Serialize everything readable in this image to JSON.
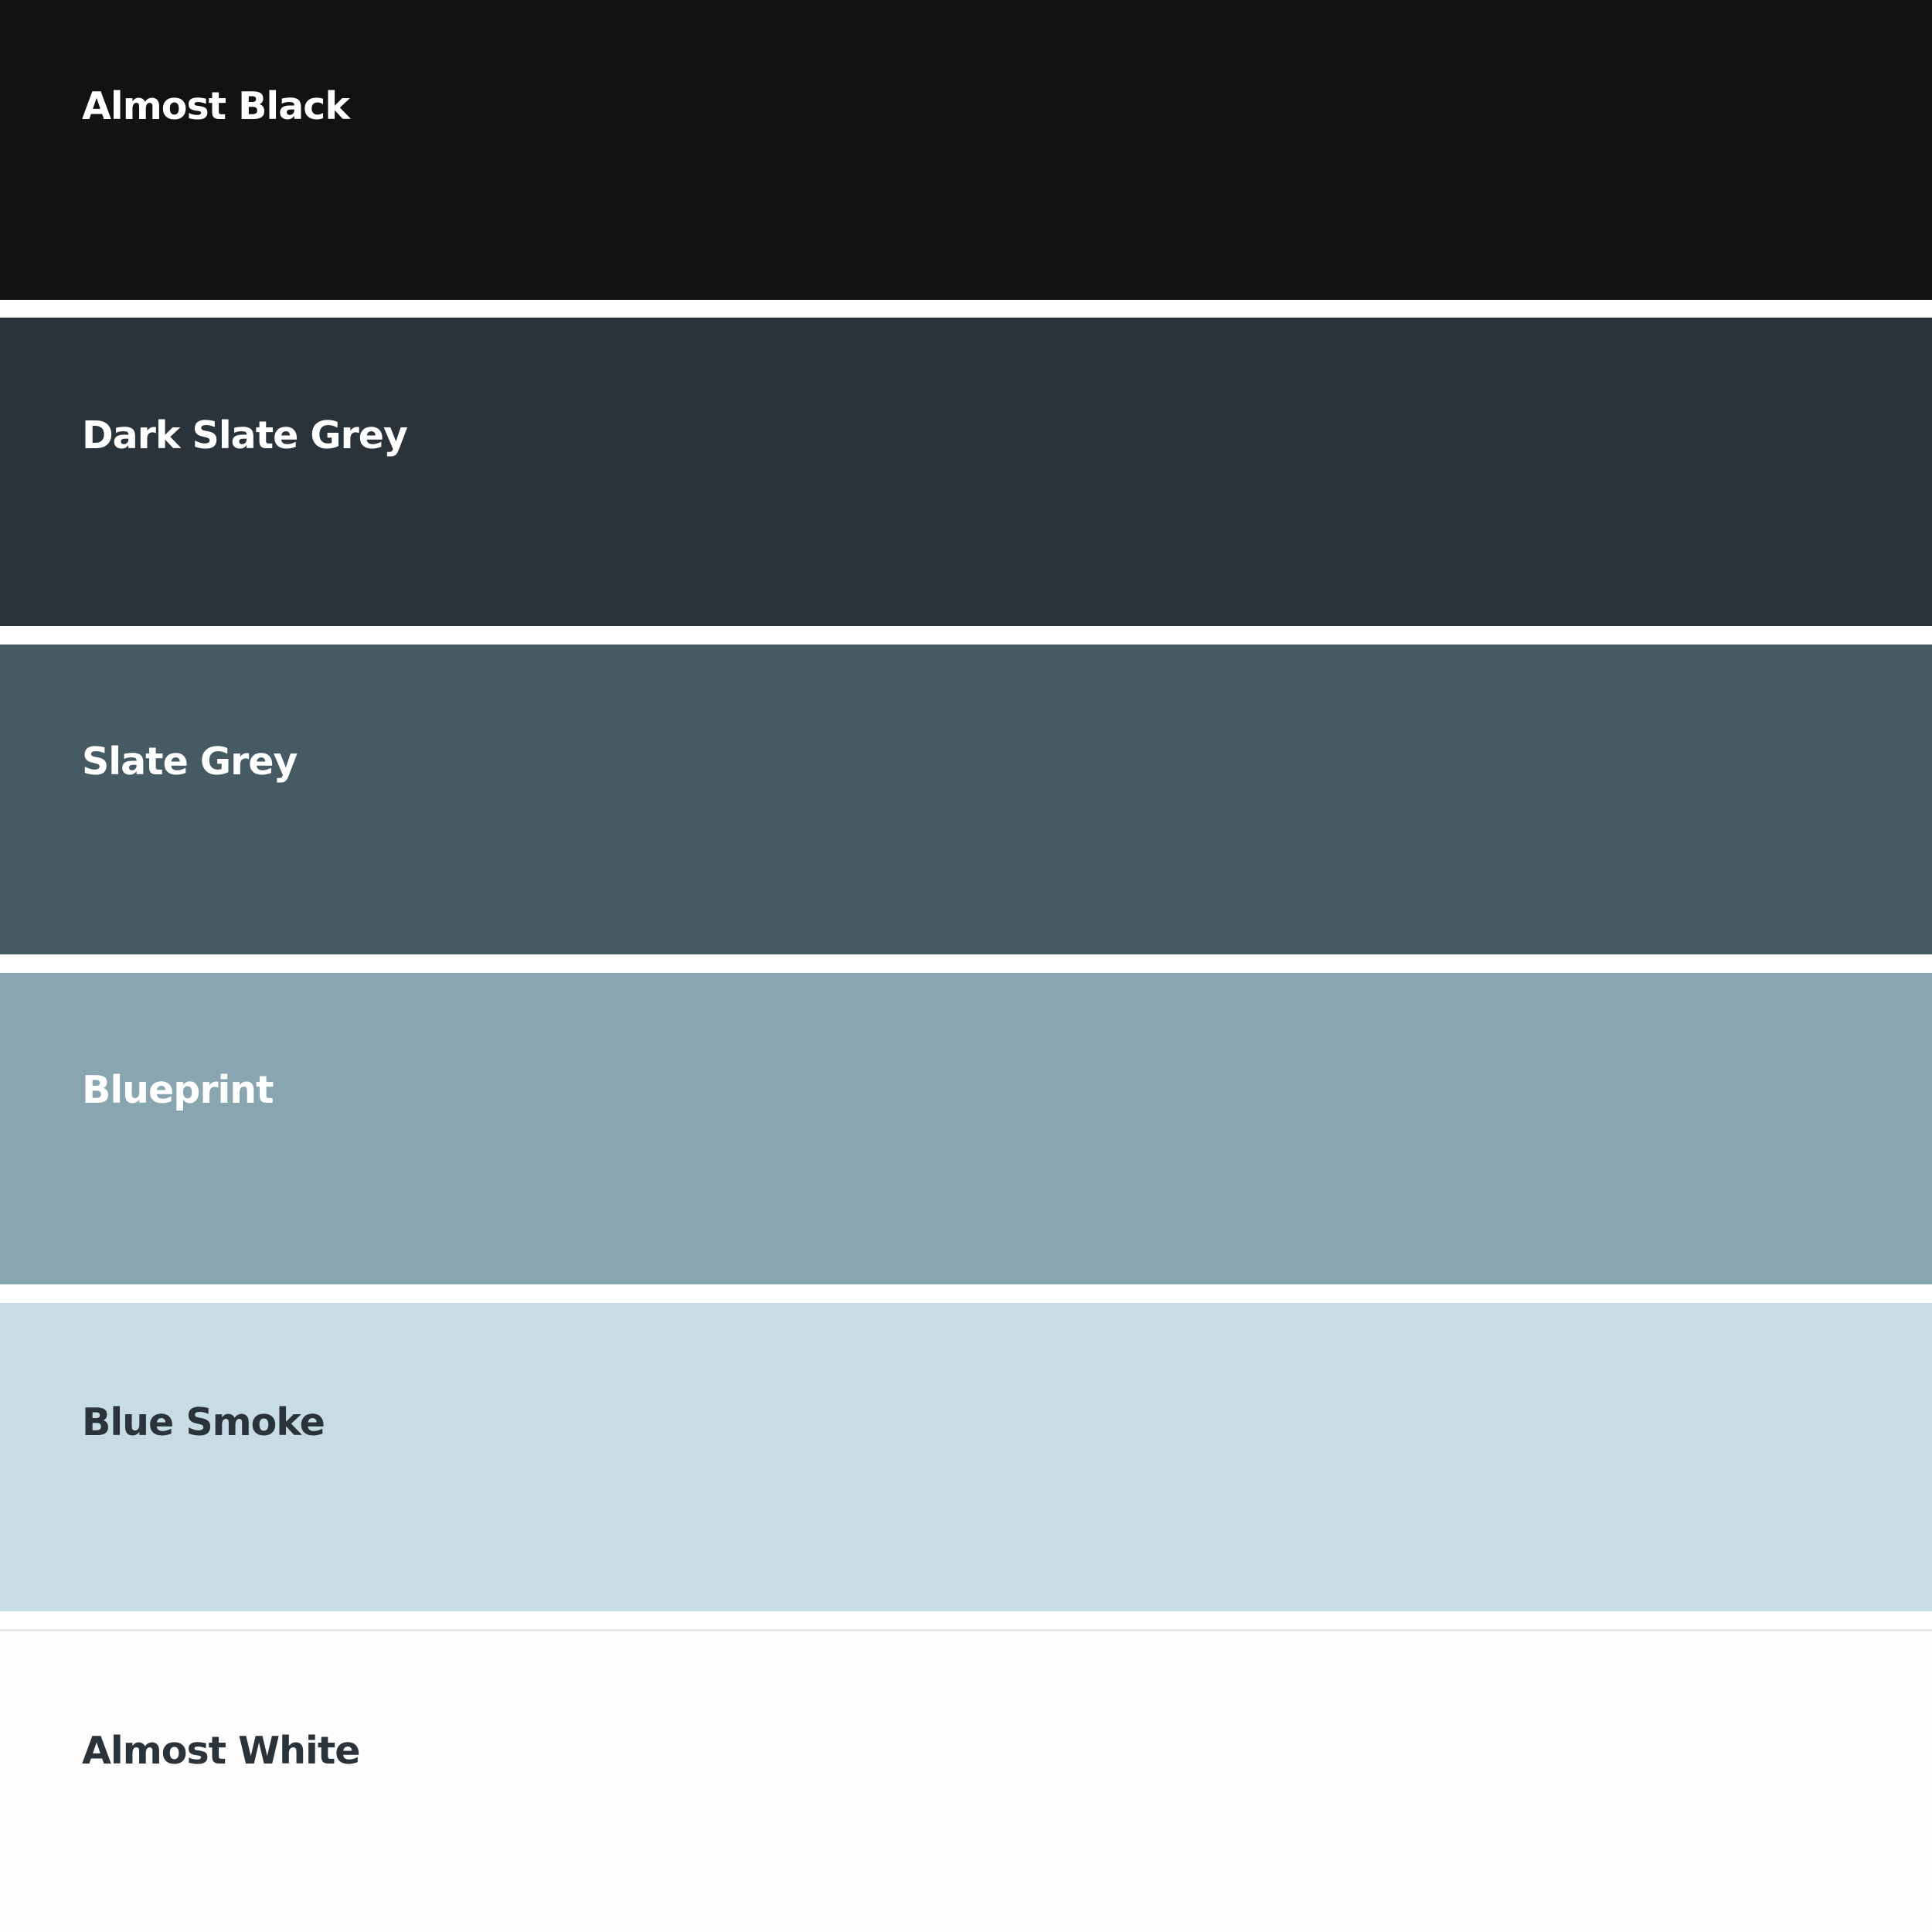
{
  "swatches": [
    {
      "name": "Almost Black",
      "color": "#121213",
      "text_color": "#ffffff"
    },
    {
      "name": "Dark Slate Grey",
      "color": "#2b333a",
      "text_color": "#ffffff"
    },
    {
      "name": "Slate Grey",
      "color": "#465a63",
      "text_color": "#ffffff"
    },
    {
      "name": "Blueprint",
      "color": "#88a5b0",
      "text_color": "#ffffff"
    },
    {
      "name": "Blue Smoke",
      "color": "#c8dce6",
      "text_color": "#2b333a"
    },
    {
      "name": "Almost White",
      "color": "#fdfdfd",
      "text_color": "#2b333a"
    }
  ]
}
